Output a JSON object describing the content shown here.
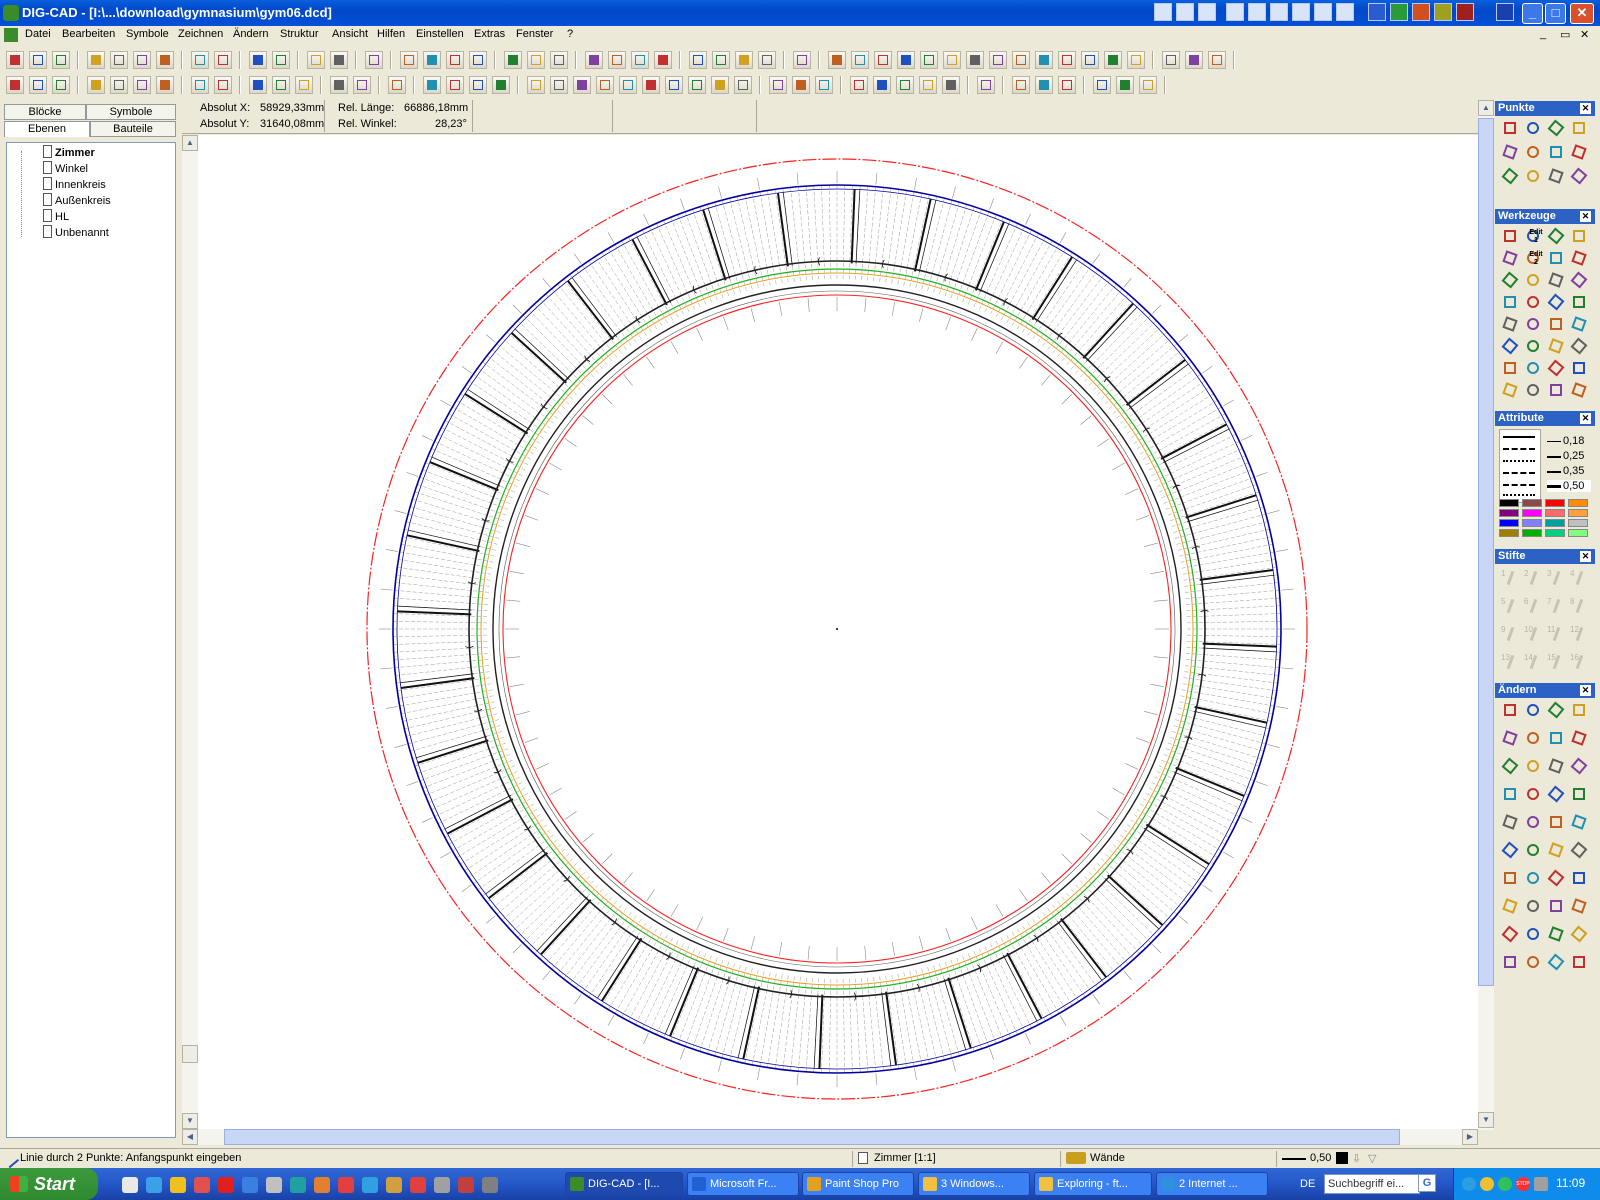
{
  "window": {
    "title": "DIG-CAD - [I:\\...\\download\\gymnasium\\gym06.dcd]",
    "controls": {
      "minimize": "_",
      "maximize": "□",
      "close": "✕"
    }
  },
  "menu": [
    "Datei",
    "Bearbeiten",
    "Symbole",
    "Zeichnen",
    "Ändern",
    "Struktur",
    "Ansicht",
    "Hilfen",
    "Einstellen",
    "Extras",
    "Fenster",
    "?"
  ],
  "left_panel": {
    "tabs_top": [
      "Blöcke",
      "Symbole"
    ],
    "tabs_bottom": [
      "Ebenen",
      "Bauteile"
    ],
    "layers": [
      {
        "name": "Zimmer",
        "bold": true
      },
      {
        "name": "Winkel",
        "bold": false
      },
      {
        "name": "Innenkreis",
        "bold": false
      },
      {
        "name": "Außenkreis",
        "bold": false
      },
      {
        "name": "HL",
        "bold": false
      },
      {
        "name": "Unbenannt",
        "bold": false
      }
    ]
  },
  "coords": {
    "abs_x_label": "Absolut X:",
    "abs_x": "58929,33mm",
    "abs_y_label": "Absolut Y:",
    "abs_y": "31640,08mm",
    "rel_len_label": "Rel. Länge:",
    "rel_len": "66886,18mm",
    "rel_ang_label": "Rel. Winkel:",
    "rel_ang": "28,23°"
  },
  "palettes": {
    "punkte": "Punkte",
    "werkzeuge": "Werkzeuge",
    "werkzeuge_edit1": "Edit 1",
    "werkzeuge_edit2": "Edit 2",
    "attribute": "Attribute",
    "line_widths": [
      "0,18",
      "0,25",
      "0,35",
      "0,50"
    ],
    "stifte": "Stifte",
    "stifte_numbers": [
      "1",
      "2",
      "3",
      "4",
      "5",
      "6",
      "7",
      "8",
      "9",
      "10",
      "11",
      "12",
      "13",
      "14",
      "15",
      "16"
    ],
    "aendern": "Ändern",
    "color_swatches": [
      "#000000",
      "#8b4a4a",
      "#ff0000",
      "#ff8c00",
      "#800080",
      "#ff00ff",
      "#ff6a6a",
      "#ffa040",
      "#0000ff",
      "#8080ff",
      "#00a0a0",
      "#c0c0c0",
      "#a08000",
      "#00b000",
      "#00d080",
      "#80ff80"
    ]
  },
  "status": {
    "hint": "Linie durch 2 Punkte: Anfangspunkt eingeben",
    "layer": "Zimmer [1:1]",
    "element": "Wände",
    "line_width": "0,50"
  },
  "taskbar": {
    "start": "Start",
    "tasks": [
      {
        "label": "DIG-CAD - [I...",
        "active": true
      },
      {
        "label": "Microsoft Fr...",
        "active": false
      },
      {
        "label": "Paint Shop Pro",
        "active": false
      },
      {
        "label": "3 Windows...",
        "active": false
      },
      {
        "label": "Exploring - ft...",
        "active": false
      },
      {
        "label": "2 Internet ...",
        "active": false
      }
    ],
    "lang": "DE",
    "search_placeholder": "Suchbegriff ei...",
    "clock": "11:09"
  },
  "drawing": {
    "colors": {
      "outer_circle": "#ff2020",
      "wall_outer": "#0000a0",
      "wall_inner": "#202020",
      "green_ring": "#20b020",
      "orange_ring": "#e8a020",
      "hatch": "#9a9a9a",
      "partition": "#101010"
    },
    "room_count": 36
  }
}
